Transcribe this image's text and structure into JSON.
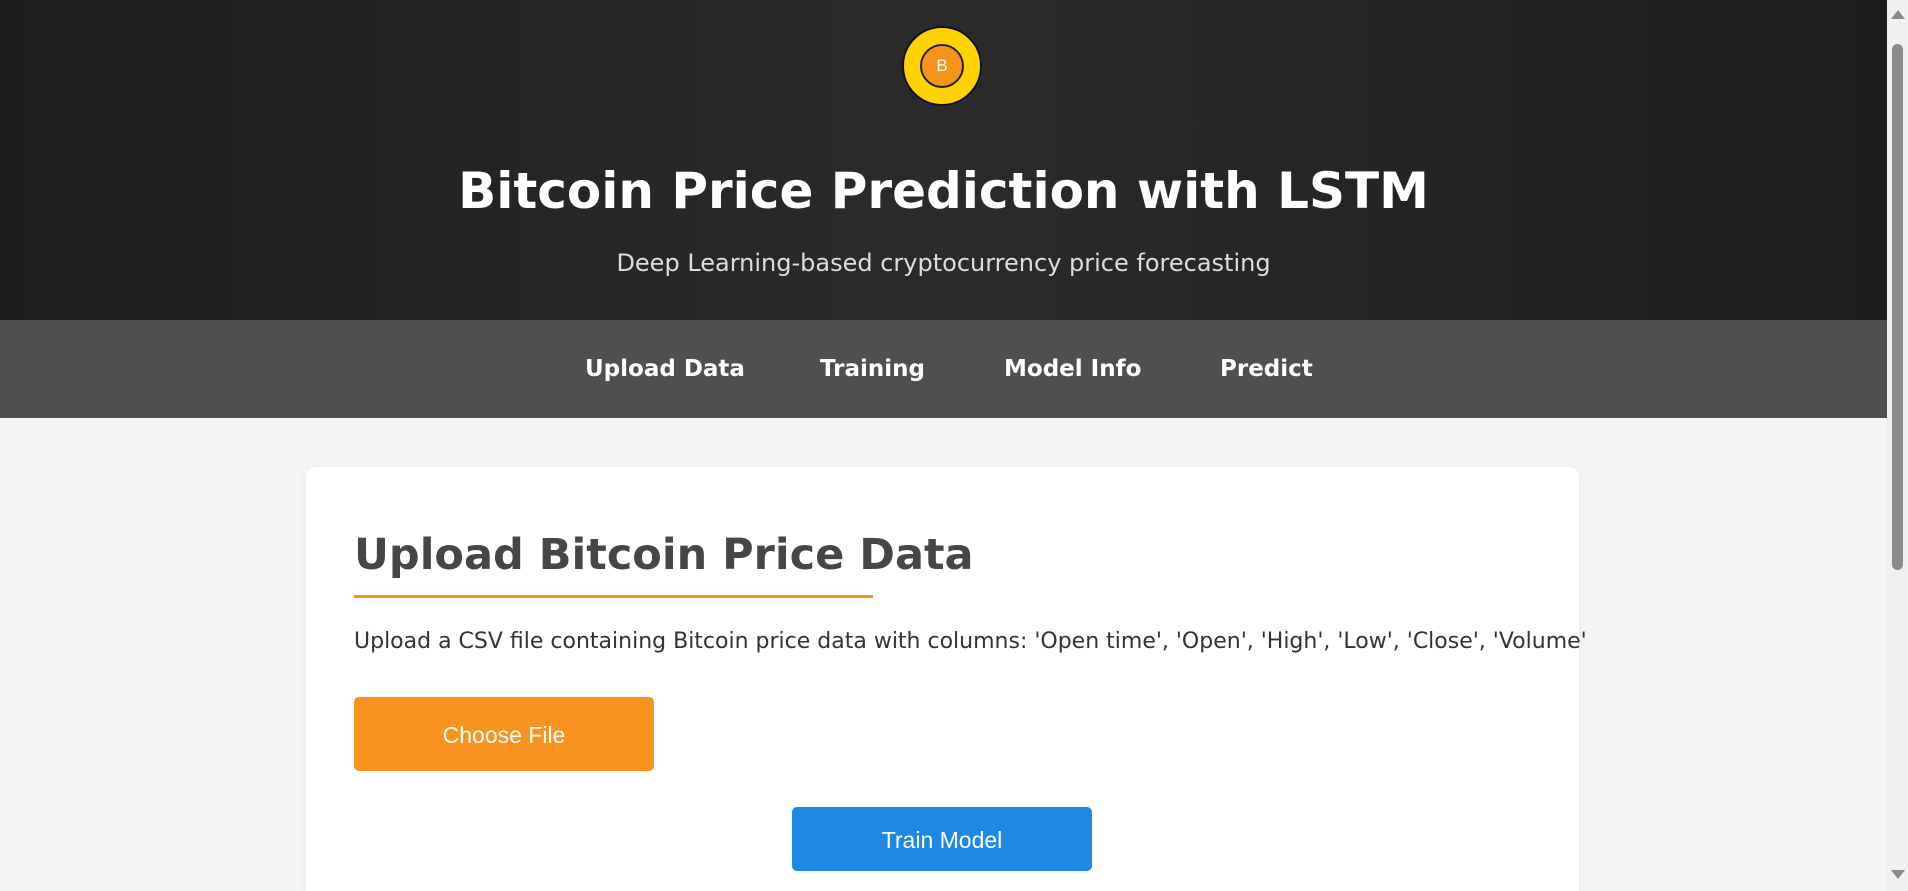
{
  "header": {
    "logo_letter": "B",
    "title": "Bitcoin Price Prediction with LSTM",
    "subtitle": "Deep Learning-based cryptocurrency price forecasting"
  },
  "nav": {
    "items": [
      {
        "label": "Upload Data"
      },
      {
        "label": "Training"
      },
      {
        "label": "Model Info"
      },
      {
        "label": "Predict"
      }
    ]
  },
  "upload": {
    "heading": "Upload Bitcoin Price Data",
    "description": "Upload a CSV file containing Bitcoin price data with columns: 'Open time', 'Open', 'High', 'Low', 'Close', 'Volume'",
    "choose_file_label": "Choose File",
    "train_label": "Train Model"
  },
  "colors": {
    "accent_orange": "#f7931e",
    "primary_blue": "#1e88e5",
    "header_dark": "#222222",
    "nav_gray": "#4f4f4f",
    "logo_yellow": "#ffd200"
  },
  "icons": {
    "logo": "bitcoin-coin-icon",
    "scroll_up": "triangle-up-icon",
    "scroll_down": "triangle-down-icon"
  }
}
